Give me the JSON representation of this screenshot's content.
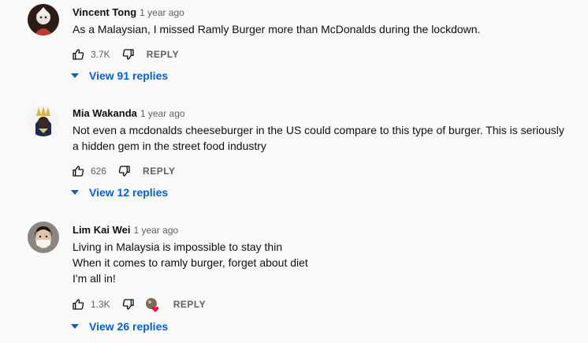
{
  "comments": [
    {
      "author": "Vincent Tong",
      "time": "1 year ago",
      "lines": [
        "As a Malaysian, I missed Ramly Burger more than McDonalds during the lockdown."
      ],
      "likes": "3.7K",
      "reply_label": "REPLY",
      "view_replies": "View 91 replies",
      "avatar_icon": "avatar-vincent-icon",
      "hearted": false
    },
    {
      "author": "Mia Wakanda",
      "time": "1 year ago",
      "lines": [
        "Not even a mcdonalds cheeseburger in the US could compare to this type of burger. This is seriously",
        "a hidden gem in the street food industry"
      ],
      "likes": "626",
      "reply_label": "REPLY",
      "view_replies": "View 12 replies",
      "avatar_icon": "avatar-mia-icon",
      "hearted": false
    },
    {
      "author": "Lim Kai Wei",
      "time": "1 year ago",
      "lines": [
        "Living in Malaysia is impossible to stay thin",
        "When it comes to ramly burger, forget about diet",
        "I'm all in!"
      ],
      "likes": "1.3K",
      "reply_label": "REPLY",
      "view_replies": "View 26 replies",
      "avatar_icon": "avatar-lim-icon",
      "hearted": true
    }
  ],
  "colors": {
    "link_blue": "#065fd4",
    "meta_gray": "#606060",
    "heart_red": "#ff0033"
  }
}
